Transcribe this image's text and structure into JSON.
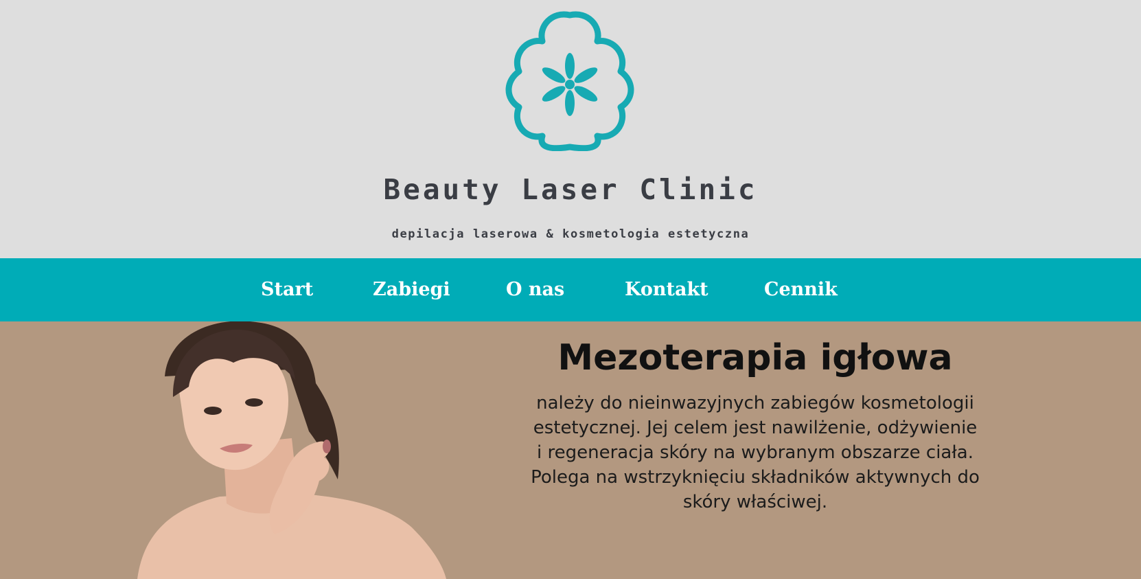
{
  "header": {
    "logo_icon": "flower-asterisk-icon",
    "title": "Beauty Laser Clinic",
    "subtitle": "depilacja laserowa & kosmetologia estetyczna"
  },
  "nav": {
    "items": [
      {
        "label": "Start"
      },
      {
        "label": "Zabiegi"
      },
      {
        "label": "O nas"
      },
      {
        "label": "Kontakt"
      },
      {
        "label": "Cennik"
      }
    ]
  },
  "hero": {
    "title": "Mezoterapia igłowa",
    "text": "należy do nieinwazyjnych zabiegów kosmetologii estetycznej. Jej celem jest nawilżenie, odżywienie i regeneracja skóry na wybranym obszarze ciała. Polega na wstrzyknięciu składników aktywnych do skóry właściwej."
  },
  "colors": {
    "header_bg": "#dedede",
    "accent": "#00acb7",
    "hero_bg": "#b39880",
    "text_dark": "#3a3d44"
  }
}
